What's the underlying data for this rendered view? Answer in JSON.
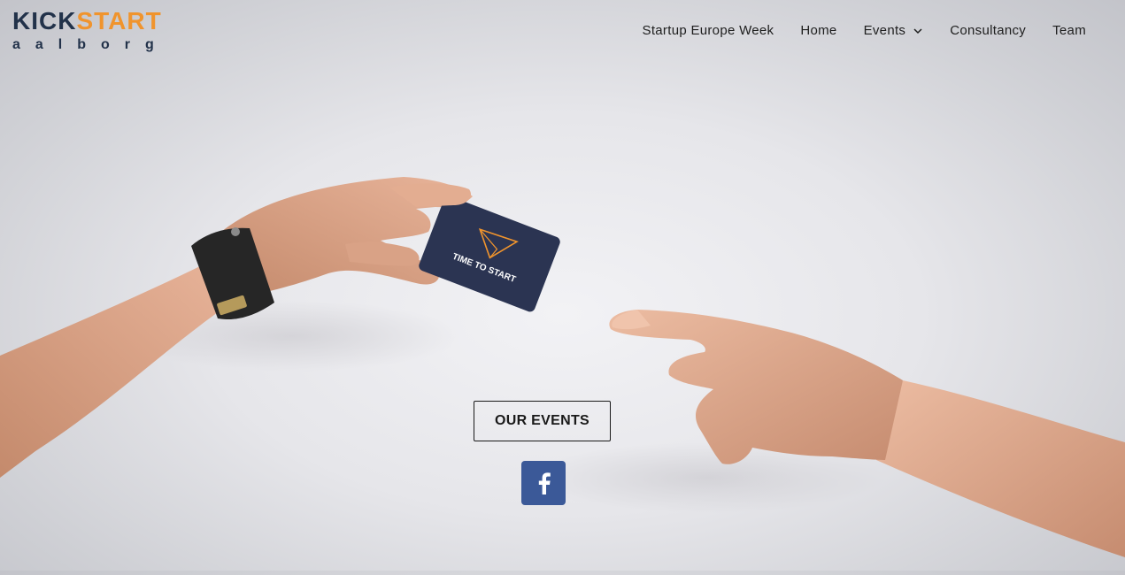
{
  "logo": {
    "part1": "KICK",
    "part2": "START",
    "sub": "aalborg"
  },
  "nav": {
    "items": [
      {
        "label": "Startup Europe Week"
      },
      {
        "label": "Home"
      },
      {
        "label": "Events"
      },
      {
        "label": "Consultancy"
      },
      {
        "label": "Team"
      }
    ]
  },
  "hero": {
    "card_text": "TIME TO START",
    "cta_label": "OUR EVENTS",
    "social_icon": "facebook-icon"
  },
  "colors": {
    "brand_dark": "#22324a",
    "brand_orange": "#f0942d",
    "card_navy": "#2b3452",
    "facebook_blue": "#3b5998"
  }
}
